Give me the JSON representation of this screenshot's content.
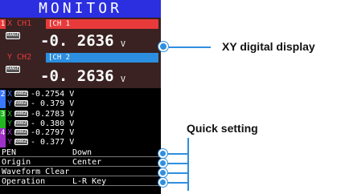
{
  "title": "MONITOR",
  "colors": {
    "title_bg": "#2b2fe0",
    "ch1_accent": "#e83a3a",
    "ch2_accent": "#2b8ee0",
    "ch_tag_2": "#3a78ff",
    "ch_tag_3": "#22b822",
    "ch_tag_4": "#a030c8",
    "callout": "#2f8fe0"
  },
  "ch1": {
    "tag": "1",
    "x_label": "X  CH1",
    "x_name": "[CH 1",
    "range_chip": "RANGE",
    "x_value": "-0. 2636",
    "x_unit": "V",
    "y_label": "Y  CH2",
    "y_name": "[CH 2",
    "y_value": "-0. 2636",
    "y_unit": "V"
  },
  "small_channels": [
    {
      "tag": "2",
      "x": "X",
      "y": "Y",
      "chip": "RANGE",
      "x_value": "-0.2754",
      "x_unit": "V",
      "y_value": "- 0.379",
      "y_unit": "V"
    },
    {
      "tag": "3",
      "x": "X",
      "y": "Y",
      "chip": "RANGE",
      "x_value": "-0.2783",
      "x_unit": "V",
      "y_value": "- 0.380",
      "y_unit": "V"
    },
    {
      "tag": "4",
      "x": "X",
      "y": "Y",
      "chip": "RANGE",
      "x_value": "-0.2797",
      "x_unit": "V",
      "y_value": "- 0.377",
      "y_unit": "V"
    }
  ],
  "settings": [
    {
      "key": "PEN",
      "value": "Down"
    },
    {
      "key": "Origin",
      "value": "Center"
    },
    {
      "key": "Waveform Clear",
      "value": ""
    },
    {
      "key": "Operation",
      "value": "L-R Key"
    }
  ],
  "callouts": {
    "xy_display": "XY digital display",
    "quick_setting": "Quick setting"
  }
}
